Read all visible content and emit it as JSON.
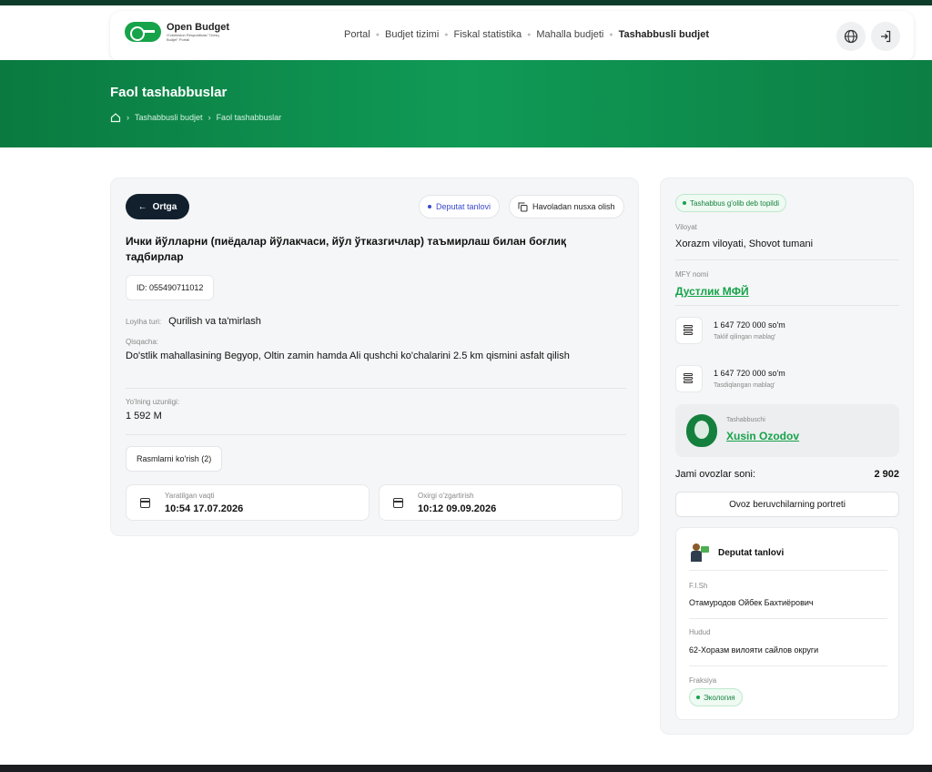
{
  "header": {
    "logo_title": "Open Budget",
    "logo_subtitle": "O'zbekiston Respublikasi \"Ochiq Budjet\" Portali",
    "nav": [
      "Portal",
      "Budjet tizimi",
      "Fiskal statistika",
      "Mahalla budjeti",
      "Tashabbusli budjet"
    ],
    "icons": [
      "globe-icon",
      "logout-icon"
    ]
  },
  "hero": {
    "title": "Faol tashabbuslar",
    "breadcrumb": [
      "Tashabbusli budjet",
      "Faol tashabbuslar"
    ]
  },
  "project": {
    "back_label": "Ortga",
    "deputat_pill": "Deputat tanlovi",
    "copy_label": "Havoladan nusxa olish",
    "title": "Ички йўлларни (пиёдалар йўлакчаси, йўл ўтказгичлар) таъмирлаш билан боғлиқ тадбирлар",
    "id": "ID: 055490711012",
    "type_label": "Loyiha turi:",
    "type_value": "Qurilish va ta'mirlash",
    "summary_label": "Qisqacha:",
    "summary_value": "Do'stlik mahallasining Begyop, Oltin zamin hamda Ali qushchi ko'chalarini 2.5 km qismini asfalt qilish",
    "length_label": "Yo'lning uzunligi:",
    "length_value": "1 592 M",
    "photos_label": "Rasmlarni ko'rish (2)",
    "created_label": "Yaratilgan vaqti",
    "created_value": "10:54 17.07.2026",
    "modified_label": "Oxirgi o'zgartirish",
    "modified_value": "10:12 09.09.2026"
  },
  "sidebar": {
    "status": "Tashabbus g'olib deb topildi",
    "region_label": "Viloyat",
    "region_value": "Xorazm viloyati, Shovot tumani",
    "mfy_label": "MFY nomi",
    "mfy_value": "Дустлик МФЙ",
    "proposed_amount": "1 647 720 000 so'm",
    "proposed_label": "Taklif qilingan mablag'",
    "approved_amount": "1 647 720 000 so'm",
    "approved_label": "Tasdiqlangan mablag'",
    "initiator_label": "Tashabbuschi",
    "initiator_name": "Xusin Ozodov",
    "votes_label": "Jami ovozlar soni:",
    "votes_value": "2 902",
    "portrait_button": "Ovoz beruvchilarning portreti"
  },
  "deputat": {
    "heading": "Deputat tanlovi",
    "fish_label": "F.I.Sh",
    "fish_value": "Отамуродов Ойбек Бахтиёрович",
    "region_label": "Hudud",
    "region_value": "62-Хоразм вилояти сайлов округи",
    "faction_label": "Fraksiya",
    "faction_value": "Экология"
  },
  "colors": {
    "brand_green": "#16a34a",
    "hero_green": "#0d8a4a",
    "dark_button": "#12202e",
    "deputat_blue": "#3b49c9"
  }
}
